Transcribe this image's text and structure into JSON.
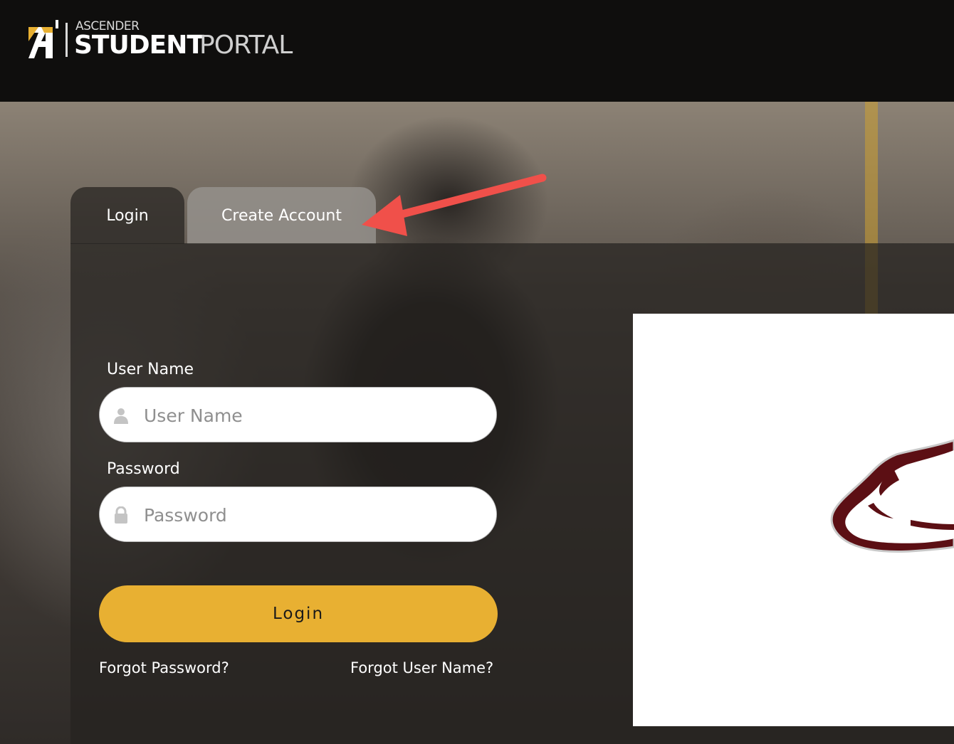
{
  "header": {
    "brand_top": "ASCENDER",
    "brand_bold": "STUDENT",
    "brand_light": "PORTAL"
  },
  "tabs": [
    {
      "label": "Login",
      "active": true
    },
    {
      "label": "Create Account",
      "active": false
    }
  ],
  "form": {
    "username_label": "User Name",
    "username_placeholder": "User Name",
    "username_value": "",
    "username_icon": "user-icon",
    "password_label": "Password",
    "password_placeholder": "Password",
    "password_value": "",
    "password_icon": "lock-icon",
    "login_button": "Login",
    "forgot_password": "Forgot Password?",
    "forgot_username": "Forgot User Name?"
  },
  "colors": {
    "topbar": "#0f0e0d",
    "accent_yellow": "#e8b032",
    "annotation_red": "#f0504a",
    "mascot_maroon": "#5c0f14"
  },
  "annotation": {
    "type": "arrow",
    "points_to": "Create Account tab"
  }
}
